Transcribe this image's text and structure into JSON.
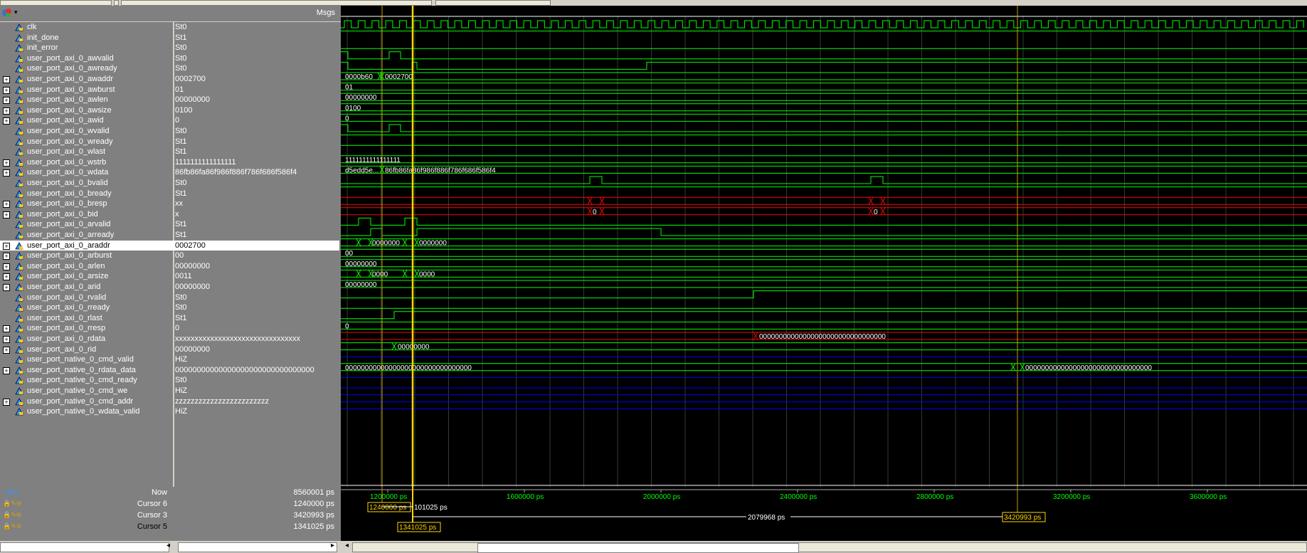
{
  "header": {
    "msgs_label": "Msgs"
  },
  "signals": [
    {
      "name": "clk",
      "value": "St0",
      "expand": false,
      "type": "clk"
    },
    {
      "name": "init_done",
      "value": "St1",
      "expand": false,
      "type": "bit"
    },
    {
      "name": "init_error",
      "value": "St0",
      "expand": false,
      "type": "bit"
    },
    {
      "name": "user_port_axi_0_awvalid",
      "value": "St0",
      "expand": false,
      "type": "bit"
    },
    {
      "name": "user_port_axi_0_awready",
      "value": "St0",
      "expand": false,
      "type": "bit"
    },
    {
      "name": "user_port_axi_0_awaddr",
      "value": "0002700",
      "expand": true,
      "type": "bus"
    },
    {
      "name": "user_port_axi_0_awburst",
      "value": "01",
      "expand": true,
      "type": "bus"
    },
    {
      "name": "user_port_axi_0_awlen",
      "value": "00000000",
      "expand": true,
      "type": "bus"
    },
    {
      "name": "user_port_axi_0_awsize",
      "value": "0100",
      "expand": true,
      "type": "bus"
    },
    {
      "name": "user_port_axi_0_awid",
      "value": "0",
      "expand": true,
      "type": "bus"
    },
    {
      "name": "user_port_axi_0_wvalid",
      "value": "St0",
      "expand": false,
      "type": "bit"
    },
    {
      "name": "user_port_axi_0_wready",
      "value": "St1",
      "expand": false,
      "type": "bit"
    },
    {
      "name": "user_port_axi_0_wlast",
      "value": "St1",
      "expand": false,
      "type": "bit"
    },
    {
      "name": "user_port_axi_0_wstrb",
      "value": "1111111111111111",
      "expand": true,
      "type": "bus"
    },
    {
      "name": "user_port_axi_0_wdata",
      "value": "86fb86fa86f986f886f786f686f586f4",
      "expand": true,
      "type": "bus"
    },
    {
      "name": "user_port_axi_0_bvalid",
      "value": "St0",
      "expand": false,
      "type": "bit"
    },
    {
      "name": "user_port_axi_0_bready",
      "value": "St1",
      "expand": false,
      "type": "bit"
    },
    {
      "name": "user_port_axi_0_bresp",
      "value": "xx",
      "expand": true,
      "type": "bus"
    },
    {
      "name": "user_port_axi_0_bid",
      "value": "x",
      "expand": true,
      "type": "bus"
    },
    {
      "name": "user_port_axi_0_arvalid",
      "value": "St1",
      "expand": false,
      "type": "bit"
    },
    {
      "name": "user_port_axi_0_arready",
      "value": "St1",
      "expand": false,
      "type": "bit"
    },
    {
      "name": "user_port_axi_0_araddr",
      "value": "0002700",
      "expand": true,
      "type": "bus",
      "selected": true
    },
    {
      "name": "user_port_axi_0_arburst",
      "value": "00",
      "expand": true,
      "type": "bus"
    },
    {
      "name": "user_port_axi_0_arlen",
      "value": "00000000",
      "expand": true,
      "type": "bus"
    },
    {
      "name": "user_port_axi_0_arsize",
      "value": "0011",
      "expand": true,
      "type": "bus"
    },
    {
      "name": "user_port_axi_0_arid",
      "value": "00000000",
      "expand": true,
      "type": "bus"
    },
    {
      "name": "user_port_axi_0_rvalid",
      "value": "St0",
      "expand": false,
      "type": "bit"
    },
    {
      "name": "user_port_axi_0_rready",
      "value": "St0",
      "expand": false,
      "type": "bit"
    },
    {
      "name": "user_port_axi_0_rlast",
      "value": "St1",
      "expand": false,
      "type": "bit"
    },
    {
      "name": "user_port_axi_0_rresp",
      "value": "0",
      "expand": true,
      "type": "bus"
    },
    {
      "name": "user_port_axi_0_rdata",
      "value": "xxxxxxxxxxxxxxxxxxxxxxxxxxxxxxxx",
      "expand": true,
      "type": "bus"
    },
    {
      "name": "user_port_axi_0_rid",
      "value": "00000000",
      "expand": true,
      "type": "bus"
    },
    {
      "name": "user_port_native_0_cmd_valid",
      "value": "HiZ",
      "expand": false,
      "type": "bit"
    },
    {
      "name": "user_port_native_0_rdata_data",
      "value": "00000000000000000000000000000000",
      "expand": true,
      "type": "bus"
    },
    {
      "name": "user_port_native_0_cmd_ready",
      "value": "St0",
      "expand": false,
      "type": "bit"
    },
    {
      "name": "user_port_native_0_cmd_we",
      "value": "HiZ",
      "expand": false,
      "type": "bit"
    },
    {
      "name": "user_port_native_0_cmd_addr",
      "value": "zzzzzzzzzzzzzzzzzzzzzzzz",
      "expand": true,
      "type": "bus"
    },
    {
      "name": "user_port_native_0_wdata_valid",
      "value": "HiZ",
      "expand": false,
      "type": "bit"
    }
  ],
  "bus_labels": {
    "awaddr_a": "0000b60",
    "awaddr_b": "0002700",
    "awburst": "01",
    "awlen": "00000000",
    "awsize": "0100",
    "awid": "0",
    "wstrb": "1111111111111111",
    "wdata_a": "d5edd5e...",
    "wdata_b": "86fb86fa86f986f886f786f686f586f4",
    "bresp_a": "",
    "bid_a": "0",
    "bid_b": "0",
    "araddr_a": "0000000",
    "araddr_b": "0000000",
    "arburst": "00",
    "arlen": "00000000",
    "arsize_a": "0000",
    "arsize_b": "0000",
    "arid": "00000000",
    "rresp": "0",
    "rdata": "00000000000000000000000000000000",
    "rid": "00000000",
    "native_rdata_a": "00000000000000000000000000000000",
    "native_rdata_b": "00000000000000000000000000000000"
  },
  "timeline": {
    "ticks": [
      "1200000 ps",
      "1600000 ps",
      "2000000 ps",
      "2400000 ps",
      "2800000 ps",
      "3200000 ps",
      "3600000 ps"
    ]
  },
  "cursors": [
    {
      "name": "Now",
      "value": "8560001 ps"
    },
    {
      "name": "Cursor 6",
      "value": "1240000 ps"
    },
    {
      "name": "Cursor 3",
      "value": "3420993 ps"
    },
    {
      "name": "Cursor 5",
      "value": "1341025 ps"
    }
  ],
  "cursor_boxes": {
    "c6": "1240000 ps",
    "delta_6_5": "101025 ps",
    "delta_5_3": "2079968 ps",
    "c3": "3420993 ps",
    "c5": "1341025 ps"
  },
  "colors": {
    "green": "#00ff00",
    "red": "#ff0000",
    "blue": "#0000ff",
    "yellow": "#ffd700",
    "grid": "#2f4f2f"
  }
}
